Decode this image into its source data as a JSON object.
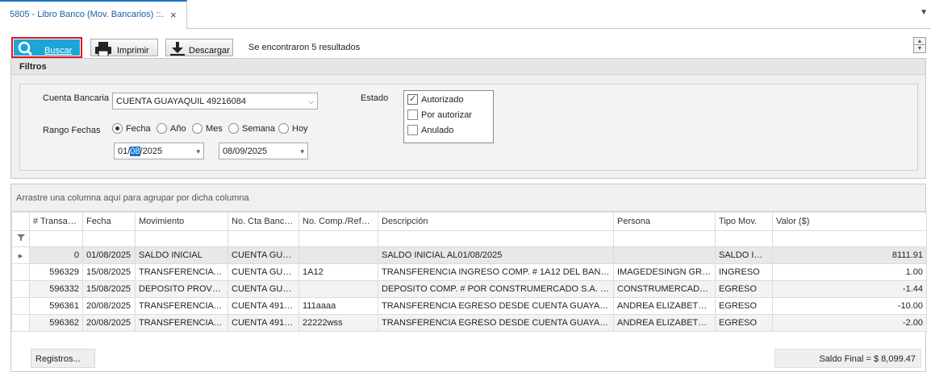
{
  "tab": {
    "title": "5805 - Libro Banco (Mov. Bancarios) ::.",
    "close": "×"
  },
  "toolbar": {
    "buscar_label": "Buscar",
    "imprimir_label": "Imprimir",
    "descargar_label": "Descargar",
    "result_text": "Se encontraron 5 resultados"
  },
  "colors": {
    "buscar_bg": "#1ca6d8",
    "highlight_border": "#e0141e",
    "tab_text": "#1a5ea8"
  },
  "filtros": {
    "title": "Filtros",
    "cuenta_label": "Cuenta Bancaria",
    "cuenta_value": "CUENTA GUAYAQUIL 49216084",
    "rango_label": "Rango Fechas",
    "rango_options": [
      "Fecha",
      "Año",
      "Mes",
      "Semana",
      "Hoy"
    ],
    "rango_selected": "Fecha",
    "fecha_desde": {
      "pre": "01/",
      "sel": "08",
      "post": "/2025"
    },
    "fecha_hasta": "08/09/2025",
    "estado_label": "Estado",
    "estado_options": [
      {
        "label": "Autorizado",
        "checked": true
      },
      {
        "label": "Por autorizar",
        "checked": false
      },
      {
        "label": "Anulado",
        "checked": false
      }
    ]
  },
  "grid": {
    "group_hint": "Arrastre una columna aquí para agrupar por dicha columna",
    "columns": [
      "# Transac...",
      "Fecha",
      "Movimiento",
      "No. Cta Banco ...",
      "No. Comp./Refer...",
      "Descripción",
      "Persona",
      "Tipo Mov.",
      "Valor ($)"
    ],
    "rows": [
      [
        "0",
        "01/08/2025",
        "SALDO INICIAL",
        "CUENTA GUAY...",
        "",
        "SALDO INICIAL AL01/08/2025",
        "",
        "SALDO INI...",
        "8111.91"
      ],
      [
        "596329",
        "15/08/2025",
        "TRANSFERENCIA IN...",
        "CUENTA GUAY...",
        "1A12",
        "TRANSFERENCIA INGRESO COMP. # 1A12 DEL BANCO B...",
        "IMAGEDESINGN GROU...",
        "INGRESO",
        "1.00"
      ],
      [
        "596332",
        "15/08/2025",
        "DEPOSITO PROVEE...",
        "CUENTA GUAY...",
        "",
        "DEPOSITO COMP. # POR CONSTRUMERCADO S.A. FEC...",
        "CONSTRUMERCADO S...",
        "EGRESO",
        "-1.44"
      ],
      [
        "596361",
        "20/08/2025",
        "TRANSFERENCIA E...",
        "CUENTA  4918...",
        "111aaaa",
        "TRANSFERENCIA EGRESO DESDE CUENTA GUAYAQUIL 4...",
        "ANDREA ELIZABETH A...",
        "EGRESO",
        "-10.00"
      ],
      [
        "596362",
        "20/08/2025",
        "TRANSFERENCIA E...",
        "CUENTA  4918...",
        "22222wss",
        "TRANSFERENCIA EGRESO DESDE CUENTA GUAYAQUIL 4...",
        "ANDREA ELIZABETH A...",
        "EGRESO",
        "-2.00"
      ]
    ],
    "registros_label": "Registros...",
    "saldo_final": "Saldo Final = $ 8,099.47"
  }
}
